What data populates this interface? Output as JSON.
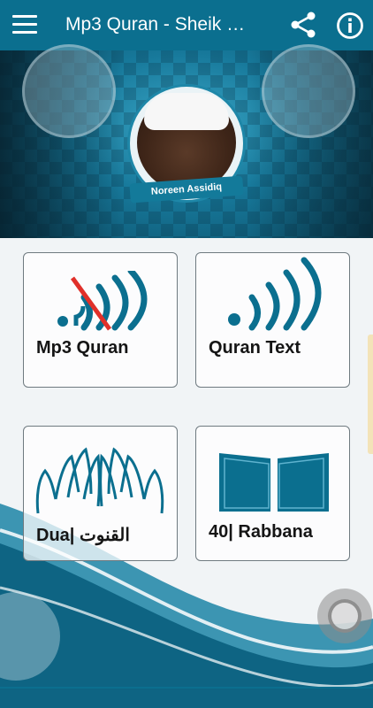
{
  "appbar": {
    "title": "Mp3 Quran - Sheik …",
    "menu_icon": "hamburger-menu-icon",
    "share_icon": "share-icon",
    "info_icon": "info-icon"
  },
  "banner": {
    "reciter_name": "Noreen Assidiq"
  },
  "tiles": [
    {
      "label": "Mp3 Quran",
      "icon": "broadcast-crossed-icon"
    },
    {
      "label": "Quran Text",
      "icon": "broadcast-icon"
    },
    {
      "label": "Dua| القنوت",
      "icon": "praying-hands-icon"
    },
    {
      "label": "40| Rabbana",
      "icon": "open-book-icon"
    }
  ],
  "colors": {
    "primary": "#0b6f8f",
    "accent_red": "#e0302a",
    "icon_blue": "#0b6f8f"
  }
}
